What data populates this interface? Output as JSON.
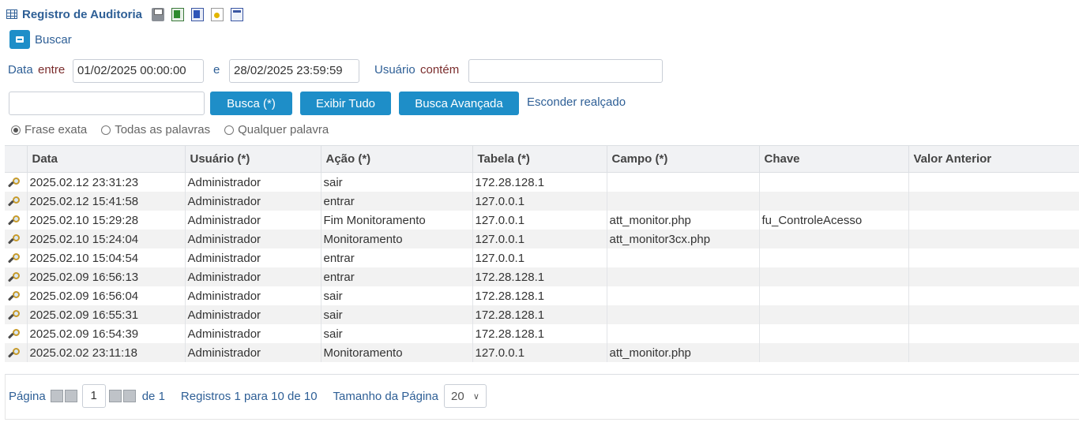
{
  "title": "Registro de Auditoria",
  "export_icons": [
    "printer-icon",
    "excel-icon",
    "word-icon",
    "pdf-icon",
    "xml-icon"
  ],
  "search_toggle": {
    "label": "Buscar"
  },
  "filters": {
    "data_label": "Data",
    "entre_label": "entre",
    "date_from": "01/02/2025 00:00:00",
    "e_label": "e",
    "date_to": "28/02/2025 23:59:59",
    "usuario_label": "Usuário",
    "contem_label": "contém",
    "usuario_value": "",
    "search_text": ""
  },
  "buttons": {
    "busca": "Busca (*)",
    "exibir_tudo": "Exibir Tudo",
    "busca_avancada": "Busca Avançada",
    "esconder_realcado": "Esconder realçado"
  },
  "radios": {
    "frase_exata": "Frase exata",
    "todas_palavras": "Todas as palavras",
    "qualquer_palavra": "Qualquer palavra",
    "selected": "Frase exata"
  },
  "table": {
    "headers": [
      "Data",
      "Usuário (*)",
      "Ação (*)",
      "Tabela (*)",
      "Campo (*)",
      "Chave",
      "Valor Anterior"
    ],
    "rows": [
      [
        "2025.02.12 23:31:23",
        "Administrador",
        "sair",
        "172.28.128.1",
        "",
        "",
        ""
      ],
      [
        "2025.02.12 15:41:58",
        "Administrador",
        "entrar",
        "127.0.0.1",
        "",
        "",
        ""
      ],
      [
        "2025.02.10 15:29:28",
        "Administrador",
        "Fim Monitoramento",
        "127.0.0.1",
        "att_monitor.php",
        "fu_ControleAcesso",
        ""
      ],
      [
        "2025.02.10 15:24:04",
        "Administrador",
        "Monitoramento",
        "127.0.0.1",
        "att_monitor3cx.php",
        "",
        ""
      ],
      [
        "2025.02.10 15:04:54",
        "Administrador",
        "entrar",
        "127.0.0.1",
        "",
        "",
        ""
      ],
      [
        "2025.02.09 16:56:13",
        "Administrador",
        "entrar",
        "172.28.128.1",
        "",
        "",
        ""
      ],
      [
        "2025.02.09 16:56:04",
        "Administrador",
        "sair",
        "172.28.128.1",
        "",
        "",
        ""
      ],
      [
        "2025.02.09 16:55:31",
        "Administrador",
        "sair",
        "172.28.128.1",
        "",
        "",
        ""
      ],
      [
        "2025.02.09 16:54:39",
        "Administrador",
        "sair",
        "172.28.128.1",
        "",
        "",
        ""
      ],
      [
        "2025.02.02 23:11:18",
        "Administrador",
        "Monitoramento",
        "127.0.0.1",
        "att_monitor.php",
        "",
        ""
      ]
    ]
  },
  "pagination": {
    "pagina_label": "Página",
    "current_page": "1",
    "de_label": "de 1",
    "registros": "Registros 1 para 10 de 10",
    "tamanho_label": "Tamanho da Página",
    "page_size": "20"
  }
}
